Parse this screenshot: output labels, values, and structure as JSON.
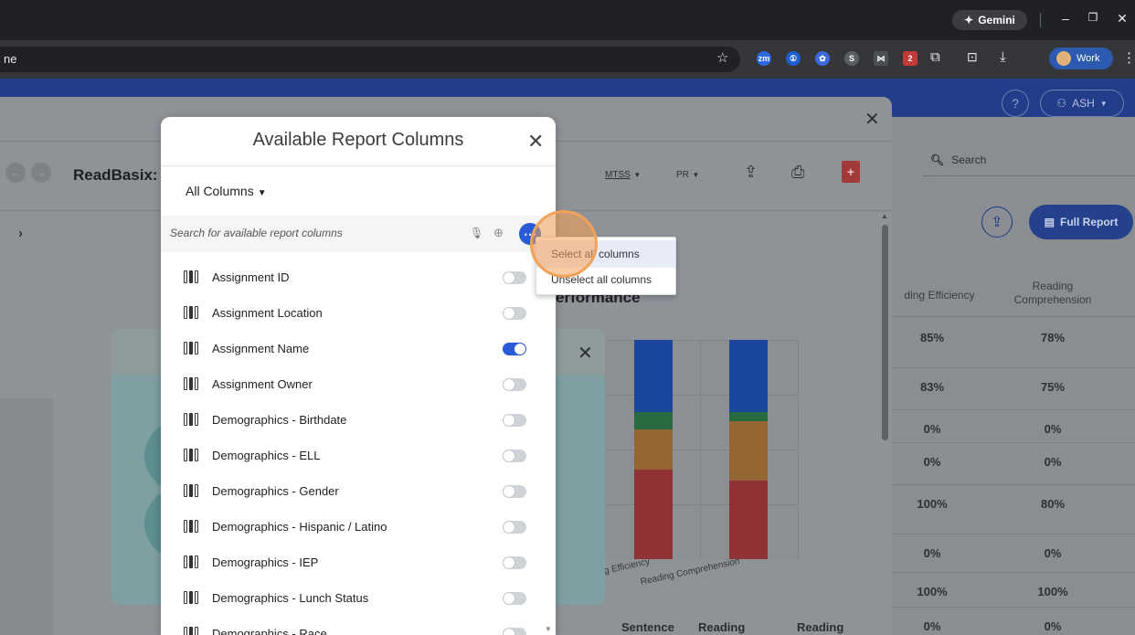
{
  "browser": {
    "gemini_label": "Gemini",
    "url_text": "ne",
    "profile_label": "Work",
    "ext_badge": "2",
    "ext_zm": "zm"
  },
  "app": {
    "help_label": "?",
    "user_label": "ASH",
    "search_label": "Search",
    "full_report_label": "Full Report",
    "table": {
      "headers": [
        "ding Efficiency",
        "Reading\nComprehension"
      ],
      "rows": [
        [
          "85%",
          "78%"
        ],
        [
          "83%",
          "75%"
        ],
        [
          "0%",
          "0%"
        ],
        [
          "0%",
          "0%"
        ],
        [
          "100%",
          "80%"
        ],
        [
          "0%",
          "0%"
        ],
        [
          "100%",
          "100%"
        ],
        [
          "0%",
          "0%"
        ]
      ]
    }
  },
  "query_report": {
    "title": "ReadBasix:",
    "mtss_label": "MTSS",
    "pr_label": "PR",
    "performance_title": "erformance",
    "chart_axis_labels": [
      "g Efficiency",
      "Reading Comprehension"
    ],
    "bottom_headers": [
      "Sentence",
      "Reading",
      "Reading"
    ]
  },
  "modal": {
    "title": "Available Report Columns",
    "filter_label": "All Columns",
    "search_placeholder": "Search for available report columns",
    "columns": [
      {
        "label": "Assignment ID",
        "on": false
      },
      {
        "label": "Assignment Location",
        "on": false
      },
      {
        "label": "Assignment Name",
        "on": true
      },
      {
        "label": "Assignment Owner",
        "on": false
      },
      {
        "label": "Demographics - Birthdate",
        "on": false
      },
      {
        "label": "Demographics - ELL",
        "on": false
      },
      {
        "label": "Demographics - Gender",
        "on": false
      },
      {
        "label": "Demographics - Hispanic / Latino",
        "on": false
      },
      {
        "label": "Demographics - IEP",
        "on": false
      },
      {
        "label": "Demographics - Lunch Status",
        "on": false
      },
      {
        "label": "Demographics - Race",
        "on": false
      }
    ]
  },
  "context_menu": {
    "select_all": "Select all columns",
    "unselect_all": "Unselect all columns"
  },
  "chart_data": {
    "type": "bar",
    "stacked": true,
    "categories": [
      "g Efficiency",
      "Reading Comprehension"
    ],
    "series": [
      {
        "color": "#a33a3d",
        "values": [
          41,
          36
        ]
      },
      {
        "color": "#a9733b",
        "values": [
          18,
          27
        ]
      },
      {
        "color": "#2f7a4a",
        "values": [
          8,
          4
        ]
      },
      {
        "color": "#1f4fb3",
        "values": [
          33,
          33
        ]
      }
    ],
    "ylim": [
      0,
      100
    ]
  }
}
